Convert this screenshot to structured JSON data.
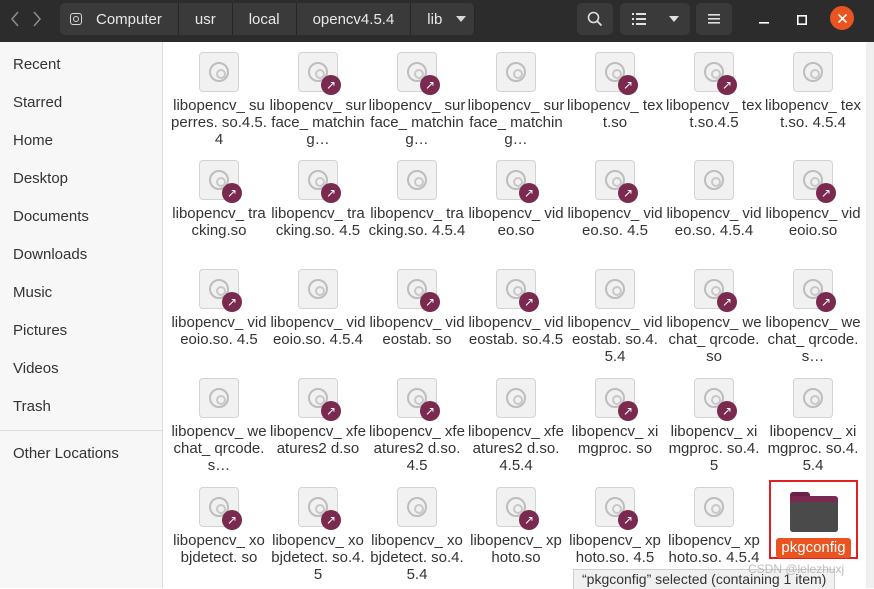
{
  "path": [
    "Computer",
    "usr",
    "local",
    "opencv4.5.4",
    "lib"
  ],
  "sidebar": [
    "Recent",
    "Starred",
    "Home",
    "Desktop",
    "Documents",
    "Downloads",
    "Music",
    "Pictures",
    "Videos",
    "Trash",
    "Other Locations"
  ],
  "files": [
    {
      "name": "libopencv_ superres. so.4.5.4",
      "link": false
    },
    {
      "name": "libopencv_ surface_ matching…",
      "link": true
    },
    {
      "name": "libopencv_ surface_ matching…",
      "link": true
    },
    {
      "name": "libopencv_ surface_ matching…",
      "link": false
    },
    {
      "name": "libopencv_ text.so",
      "link": true
    },
    {
      "name": "libopencv_ text.so.4.5",
      "link": true
    },
    {
      "name": "libopencv_ text.so. 4.5.4",
      "link": false
    },
    {
      "name": "libopencv_ tracking.so",
      "link": true
    },
    {
      "name": "libopencv_ tracking.so. 4.5",
      "link": true
    },
    {
      "name": "libopencv_ tracking.so. 4.5.4",
      "link": false
    },
    {
      "name": "libopencv_ video.so",
      "link": true
    },
    {
      "name": "libopencv_ video.so. 4.5",
      "link": true
    },
    {
      "name": "libopencv_ video.so. 4.5.4",
      "link": false
    },
    {
      "name": "libopencv_ videoio.so",
      "link": true
    },
    {
      "name": "libopencv_ videoio.so. 4.5",
      "link": true
    },
    {
      "name": "libopencv_ videoio.so. 4.5.4",
      "link": false
    },
    {
      "name": "libopencv_ videostab. so",
      "link": true
    },
    {
      "name": "libopencv_ videostab. so.4.5",
      "link": true
    },
    {
      "name": "libopencv_ videostab. so.4.5.4",
      "link": false
    },
    {
      "name": "libopencv_ wechat_ qrcode.so",
      "link": true
    },
    {
      "name": "libopencv_ wechat_ qrcode.s…",
      "link": true
    },
    {
      "name": "libopencv_ wechat_ qrcode.s…",
      "link": false
    },
    {
      "name": "libopencv_ xfeatures2 d.so",
      "link": true
    },
    {
      "name": "libopencv_ xfeatures2 d.so.4.5",
      "link": true
    },
    {
      "name": "libopencv_ xfeatures2 d.so.4.5.4",
      "link": false
    },
    {
      "name": "libopencv_ ximgproc. so",
      "link": true
    },
    {
      "name": "libopencv_ ximgproc. so.4.5",
      "link": true
    },
    {
      "name": "libopencv_ ximgproc. so.4.5.4",
      "link": false
    },
    {
      "name": "libopencv_ xobjdetect. so",
      "link": true
    },
    {
      "name": "libopencv_ xobjdetect. so.4.5",
      "link": true
    },
    {
      "name": "libopencv_ xobjdetect. so.4.5.4",
      "link": false
    },
    {
      "name": "libopencv_ xphoto.so",
      "link": true
    },
    {
      "name": "libopencv_ xphoto.so. 4.5",
      "link": true
    },
    {
      "name": "libopencv_ xphoto.so. 4.5.4",
      "link": false
    }
  ],
  "selected_folder": "pkgconfig",
  "status": "“pkgconfig” selected  (containing 1 item)",
  "watermark": "CSDN @lelezhuxj",
  "colors": {
    "accent": "#e95420",
    "symlink": "#7a2a4f",
    "headerbar": "#2c2c2c"
  },
  "icons": {
    "back": "chevron-left-icon",
    "forward": "chevron-right-icon",
    "search": "search-icon",
    "view": "list-view-icon",
    "menu": "hamburger-menu-icon"
  }
}
